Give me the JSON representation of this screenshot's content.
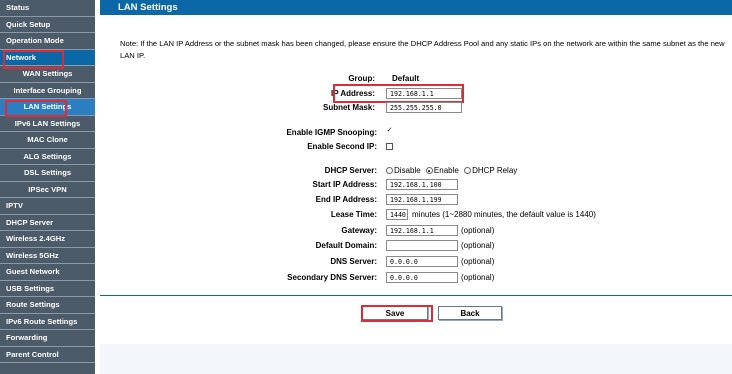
{
  "sidebar": {
    "items": [
      {
        "label": "Status"
      },
      {
        "label": "Quick Setup"
      },
      {
        "label": "Operation Mode"
      },
      {
        "label": "Network"
      },
      {
        "label": "WAN Settings"
      },
      {
        "label": "Interface Grouping"
      },
      {
        "label": "LAN Settings"
      },
      {
        "label": "IPv6 LAN Settings"
      },
      {
        "label": "MAC Clone"
      },
      {
        "label": "ALG Settings"
      },
      {
        "label": "DSL Settings"
      },
      {
        "label": "IPSec VPN"
      },
      {
        "label": "IPTV"
      },
      {
        "label": "DHCP Server"
      },
      {
        "label": "Wireless 2.4GHz"
      },
      {
        "label": "Wireless 5GHz"
      },
      {
        "label": "Guest Network"
      },
      {
        "label": "USB Settings"
      },
      {
        "label": "Route Settings"
      },
      {
        "label": "IPv6 Route Settings"
      },
      {
        "label": "Forwarding"
      },
      {
        "label": "Parent Control"
      }
    ],
    "active_color": "#0b67a6",
    "background_color": "#4c5b69"
  },
  "page": {
    "title": "LAN Settings",
    "note": "Note: If the LAN IP Address or the subnet mask has been changed, please ensure the DHCP Address Pool and any static IPs on the network are within the same subnet as the new LAN IP."
  },
  "form": {
    "group_label": "Group:",
    "group_value": "Default",
    "ip_label": "IP Address:",
    "ip_value": "192.168.1.1",
    "mask_label": "Subnet Mask:",
    "mask_value": "255.255.255.0",
    "igmp_label": "Enable IGMP Snooping:",
    "igmp_checked": "✓",
    "second_ip_label": "Enable Second IP:",
    "dhcp_label": "DHCP Server:",
    "dhcp_options": [
      "Disable",
      "Enable",
      "DHCP Relay"
    ],
    "dhcp_selected": "Enable",
    "start_label": "Start IP Address:",
    "start_value": "192.168.1.100",
    "end_label": "End IP Address:",
    "end_value": "192.168.1.199",
    "lease_label": "Lease Time:",
    "lease_value": "1440",
    "lease_hint": "minutes (1~2880 minutes, the default value is 1440)",
    "gateway_label": "Gateway:",
    "gateway_value": "192.168.1.1",
    "domain_label": "Default Domain:",
    "domain_value": "",
    "dns_label": "DNS Server:",
    "dns_value": "0.0.0.0",
    "sdns_label": "Secondary DNS Server:",
    "sdns_value": "0.0.0.0",
    "optional": "(optional)"
  },
  "buttons": {
    "save": "Save",
    "back": "Back"
  },
  "highlight_color": "#e22a36"
}
